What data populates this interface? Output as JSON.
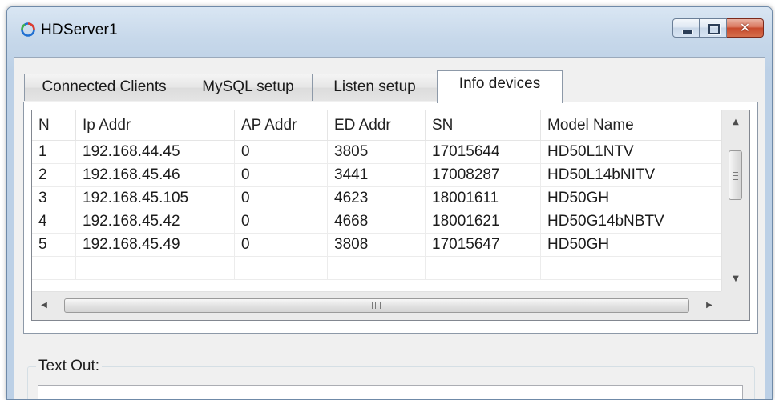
{
  "window": {
    "title": "HDServer1"
  },
  "tabs": [
    {
      "label": "Connected Clients"
    },
    {
      "label": "MySQL setup"
    },
    {
      "label": "Listen setup"
    },
    {
      "label": "Info devices",
      "active": true
    }
  ],
  "devices_table": {
    "columns": [
      "N",
      "Ip Addr",
      "AP Addr",
      "ED Addr",
      "SN",
      "Model Name"
    ],
    "rows": [
      [
        "1",
        "192.168.44.45",
        "0",
        "3805",
        "17015644",
        "HD50L1NTV"
      ],
      [
        "2",
        "192.168.45.46",
        "0",
        "3441",
        "17008287",
        "HD50L14bNITV"
      ],
      [
        "3",
        "192.168.45.105",
        "0",
        "4623",
        "18001611",
        "HD50GH"
      ],
      [
        "4",
        "192.168.45.42",
        "0",
        "4668",
        "18001621",
        "HD50G14bNBTV"
      ],
      [
        "5",
        "192.168.45.49",
        "0",
        "3808",
        "17015647",
        "HD50GH"
      ]
    ]
  },
  "text_out": {
    "label": "Text Out:",
    "value": ""
  },
  "icons": {
    "app": "app-ring-icon",
    "minimize": "minimize-icon",
    "maximize": "maximize-icon",
    "close": "close-icon"
  },
  "colors": {
    "close_button": "#c74a2d",
    "title_bar": "#c7d8ea",
    "dialog_bg": "#f0f0f0"
  }
}
